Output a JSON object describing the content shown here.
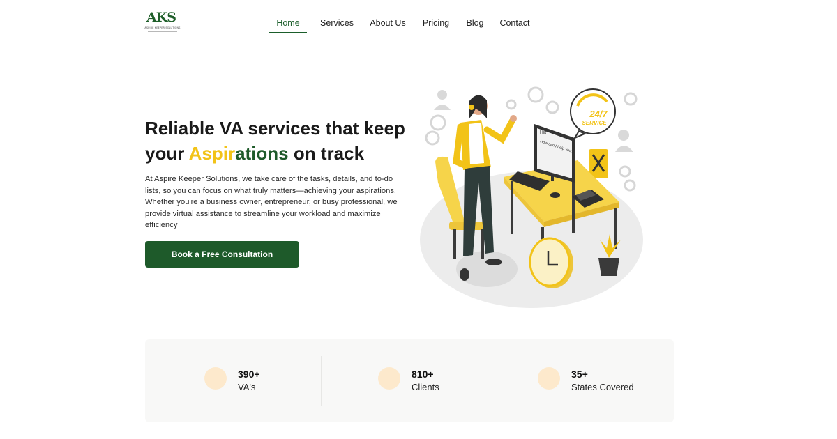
{
  "brand": {
    "logo_mark": "AKS",
    "logo_tagline": "ASPIRE KEEPER SOLUTIONS",
    "colors": {
      "primary_green": "#1e5a2a",
      "accent_yellow": "#f2c318",
      "stat_circle": "#fde9cc"
    }
  },
  "nav": {
    "items": [
      {
        "label": "Home",
        "active": true
      },
      {
        "label": "Services",
        "active": false
      },
      {
        "label": "About Us",
        "active": false
      },
      {
        "label": "Pricing",
        "active": false
      },
      {
        "label": "Blog",
        "active": false
      },
      {
        "label": "Contact",
        "active": false
      }
    ]
  },
  "hero": {
    "title_line1": "Reliable VA services that keep",
    "title_pre": "your ",
    "title_highlight_yellow": "Aspir",
    "title_highlight_green": "ations",
    "title_post": " on track",
    "description": "At Aspire Keeper Solutions, we take care of the tasks, details, and to-do lists, so you can focus on what truly matters—achieving your aspirations. Whether you're a business owner, entrepreneur, or busy professional, we provide virtual assistance to streamline your workload and maximize efficiency",
    "cta_label": "Book a Free Consultation"
  },
  "illustration": {
    "bubble_hi": "Hi!",
    "bubble_help": "How can I help you?",
    "badge_line1": "24/7",
    "badge_line2": "SERVICE",
    "icons": [
      "headset-icon",
      "gear-icon",
      "user-icon",
      "tools-icon",
      "clock-icon",
      "plant-icon",
      "phone-icon"
    ]
  },
  "stats": [
    {
      "value": "390+",
      "label": "VA's"
    },
    {
      "value": "810+",
      "label": "Clients"
    },
    {
      "value": "35+",
      "label": "States Covered"
    }
  ]
}
